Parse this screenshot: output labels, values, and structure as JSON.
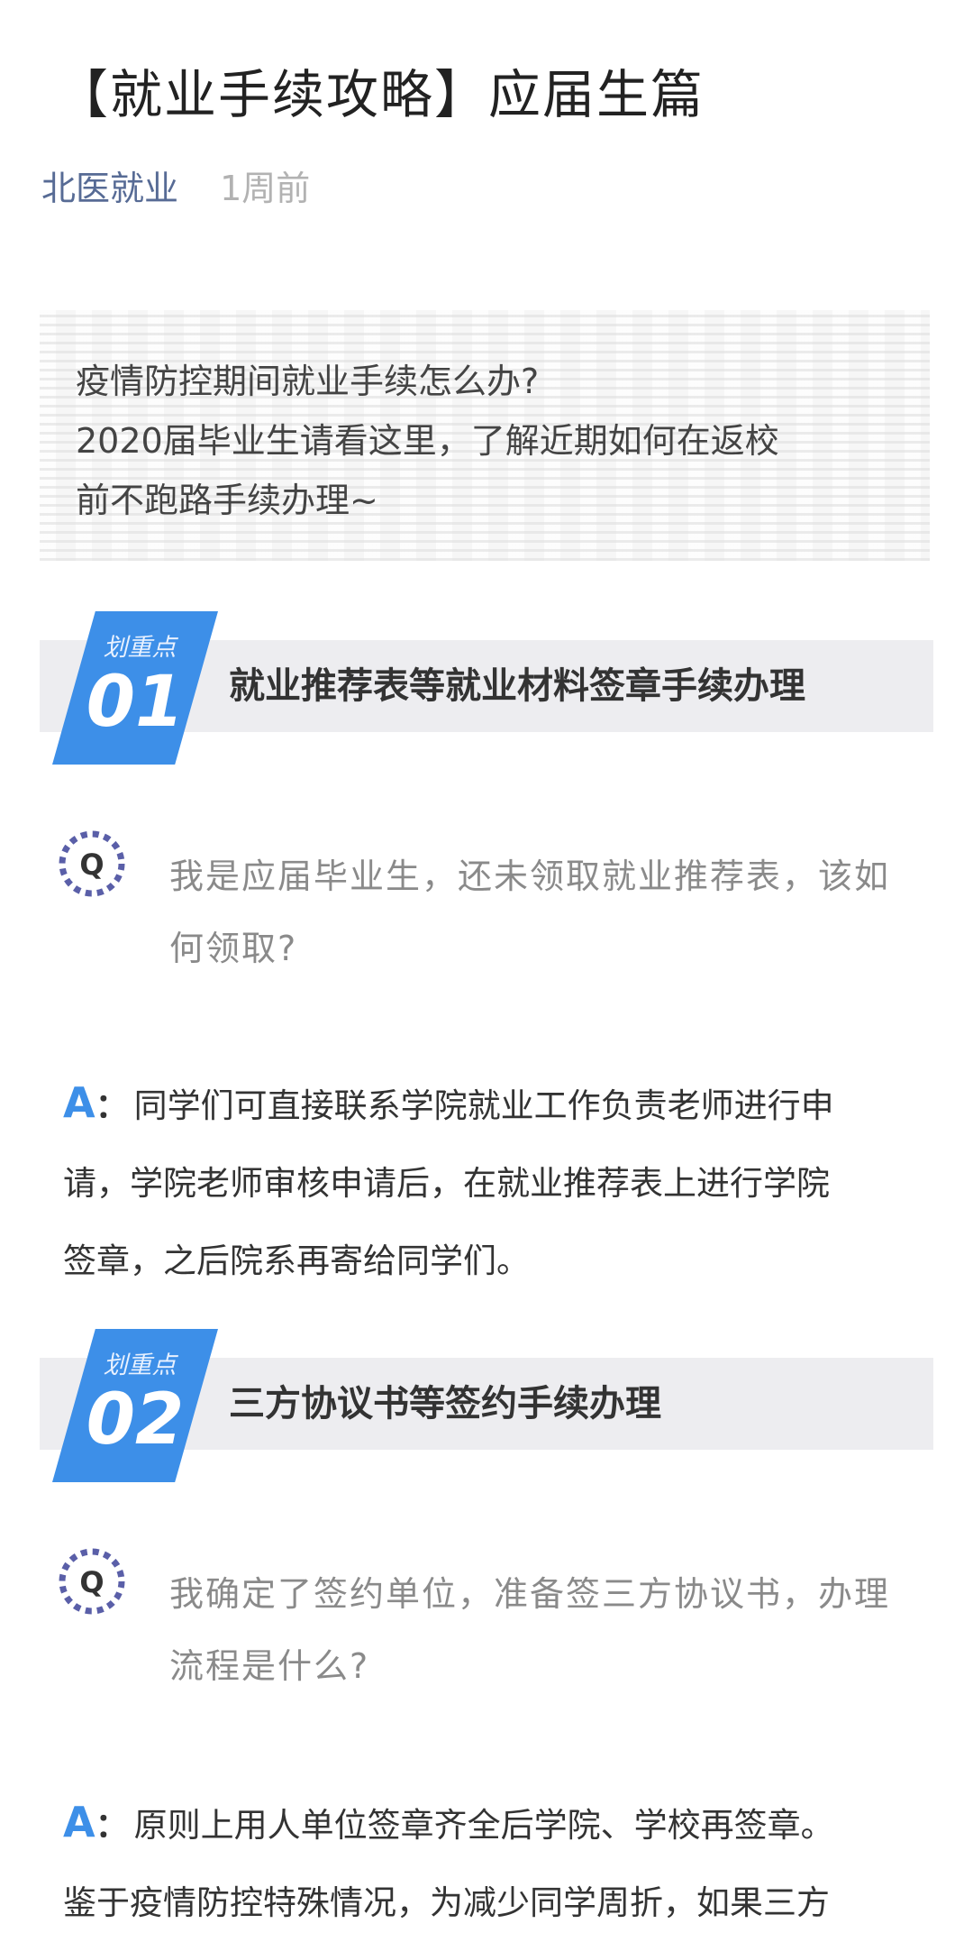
{
  "article": {
    "title": "【就业手续攻略】应届生篇",
    "author": "北医就业",
    "time": "1周前"
  },
  "intro": {
    "lines": [
      "疫情防控期间就业手续怎么办?",
      "2020届毕业生请看这里，了解近期如何在返校",
      "前不跑路手续办理~"
    ]
  },
  "sections": [
    {
      "badge_label": "划重点",
      "badge_number": "01",
      "heading": "就业推荐表等就业材料签章手续办理",
      "q_icon_letter": "Q",
      "question_lines": [
        "我是应届毕业生，还未领取就业推荐表，该如",
        "何领取?"
      ],
      "answer_label": "A",
      "answer_colon": "：",
      "answer_lines": [
        "同学们可直接联系学院就业工作负责老师进行申",
        "请，学院老师审核申请后，在就业推荐表上进行学院",
        "签章，之后院系再寄给同学们。"
      ]
    },
    {
      "badge_label": "划重点",
      "badge_number": "02",
      "heading": "三方协议书等签约手续办理",
      "q_icon_letter": "Q",
      "question_lines": [
        "我确定了签约单位，准备签三方协议书，办理",
        "流程是什么?"
      ],
      "answer_label": "A",
      "answer_colon": "：",
      "answer_lines": [
        "原则上用人单位签章齐全后学院、学校再签章。",
        "鉴于疫情防控特殊情况，为减少同学周折，如果三方"
      ]
    }
  ],
  "colors": {
    "accent": "#3d8fe8",
    "author_link": "#576b95",
    "muted": "#b2b2b2",
    "q_icon": "#5a5fa8"
  },
  "icons": {
    "question": "question-badge-icon"
  }
}
